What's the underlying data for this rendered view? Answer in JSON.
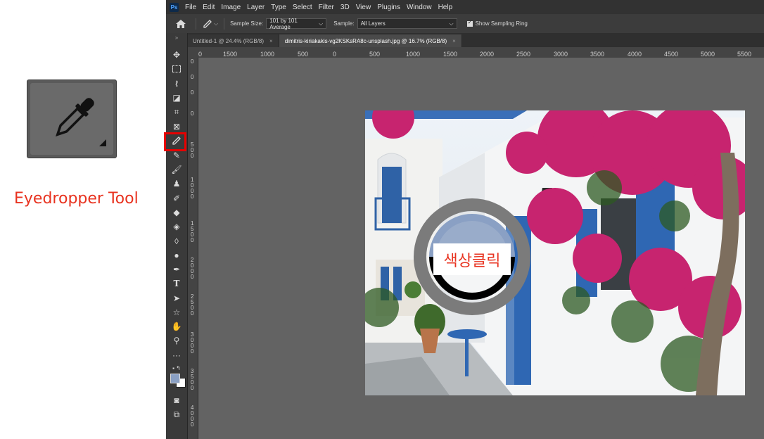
{
  "callout": {
    "label": "Eyedropper Tool",
    "icon": "eyedropper-icon"
  },
  "app": {
    "logo": "Ps",
    "menus": [
      "File",
      "Edit",
      "Image",
      "Layer",
      "Type",
      "Select",
      "Filter",
      "3D",
      "View",
      "Plugins",
      "Window",
      "Help"
    ]
  },
  "options": {
    "sample_size_label": "Sample Size:",
    "sample_size_value": "101 by 101 Average",
    "sample_label": "Sample:",
    "sample_value": "All Layers",
    "show_ring_label": "Show Sampling Ring"
  },
  "tabs": [
    {
      "label": "Untitled-1 @ 24.4% (RGB/8)"
    },
    {
      "label": "dimitris-kiriakakis-vg2KSKsRA8c-unsplash.jpg @ 16.7% (RGB/8)"
    }
  ],
  "ruler": {
    "h_ticks": [
      "0",
      "1500",
      "1000",
      "500",
      "0",
      "500",
      "1000",
      "1500",
      "2000",
      "2500",
      "3000",
      "3500",
      "4000",
      "4500",
      "5000",
      "5500"
    ],
    "v_ticks": [
      "0",
      "0",
      "0",
      "0",
      "5 0 0",
      "1 0 0 0",
      "1 5 0 0",
      "2 0 0 0",
      "2 5 0 0",
      "3 0 0 0",
      "3 5 0 0",
      "4 0 0 0"
    ]
  },
  "sampling_ring": {
    "label": "색상클릭"
  },
  "colors": {
    "foreground": "#8aa0c4",
    "background": "#ffffff",
    "highlight": "#e60000",
    "callout_text": "#e8321f"
  }
}
